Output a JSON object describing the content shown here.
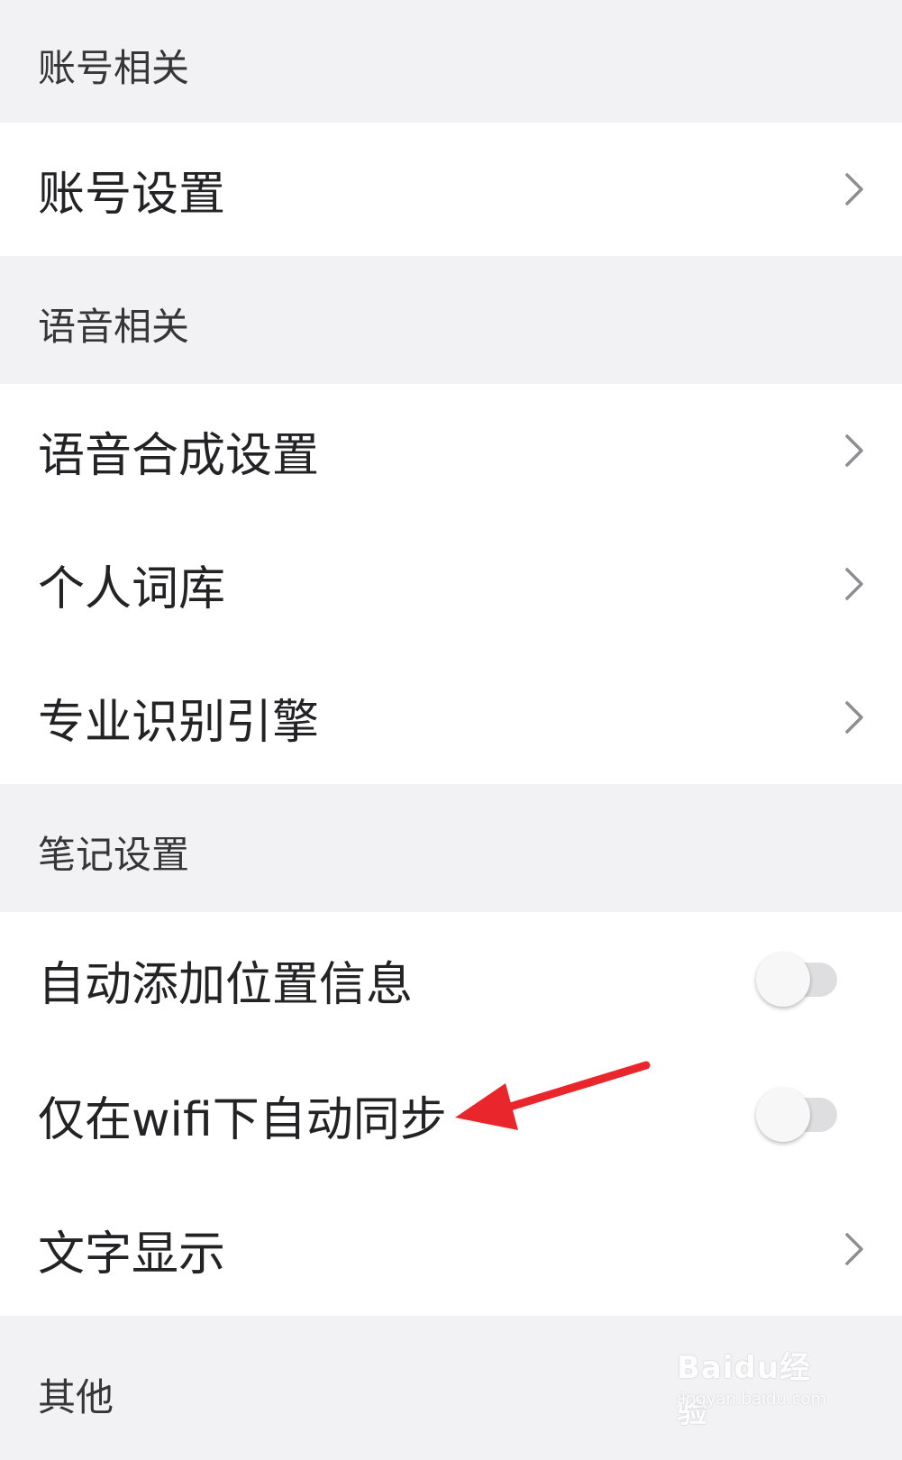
{
  "sections": [
    {
      "title": "账号相关",
      "items": [
        {
          "label": "账号设置",
          "control": "chevron"
        }
      ]
    },
    {
      "title": "语音相关",
      "items": [
        {
          "label": "语音合成设置",
          "control": "chevron"
        },
        {
          "label": "个人词库",
          "control": "chevron"
        },
        {
          "label": "专业识别引擎",
          "control": "chevron"
        }
      ]
    },
    {
      "title": "笔记设置",
      "items": [
        {
          "label": "自动添加位置信息",
          "control": "toggle",
          "on": false
        },
        {
          "label": "仅在wifi下自动同步",
          "control": "toggle",
          "on": false
        },
        {
          "label": "文字显示",
          "control": "chevron"
        }
      ]
    },
    {
      "title": "其他",
      "items": []
    }
  ],
  "annotation": {
    "color": "#e8262b",
    "target": "仅在wifi下自动同步"
  },
  "watermark": {
    "brand": "Baidu经验",
    "url": "jingyan.baidu.com"
  },
  "colors": {
    "background": "#f2f2f4",
    "row": "#ffffff",
    "chevron": "#8d8d93",
    "toggle_off": "#dedee0"
  }
}
